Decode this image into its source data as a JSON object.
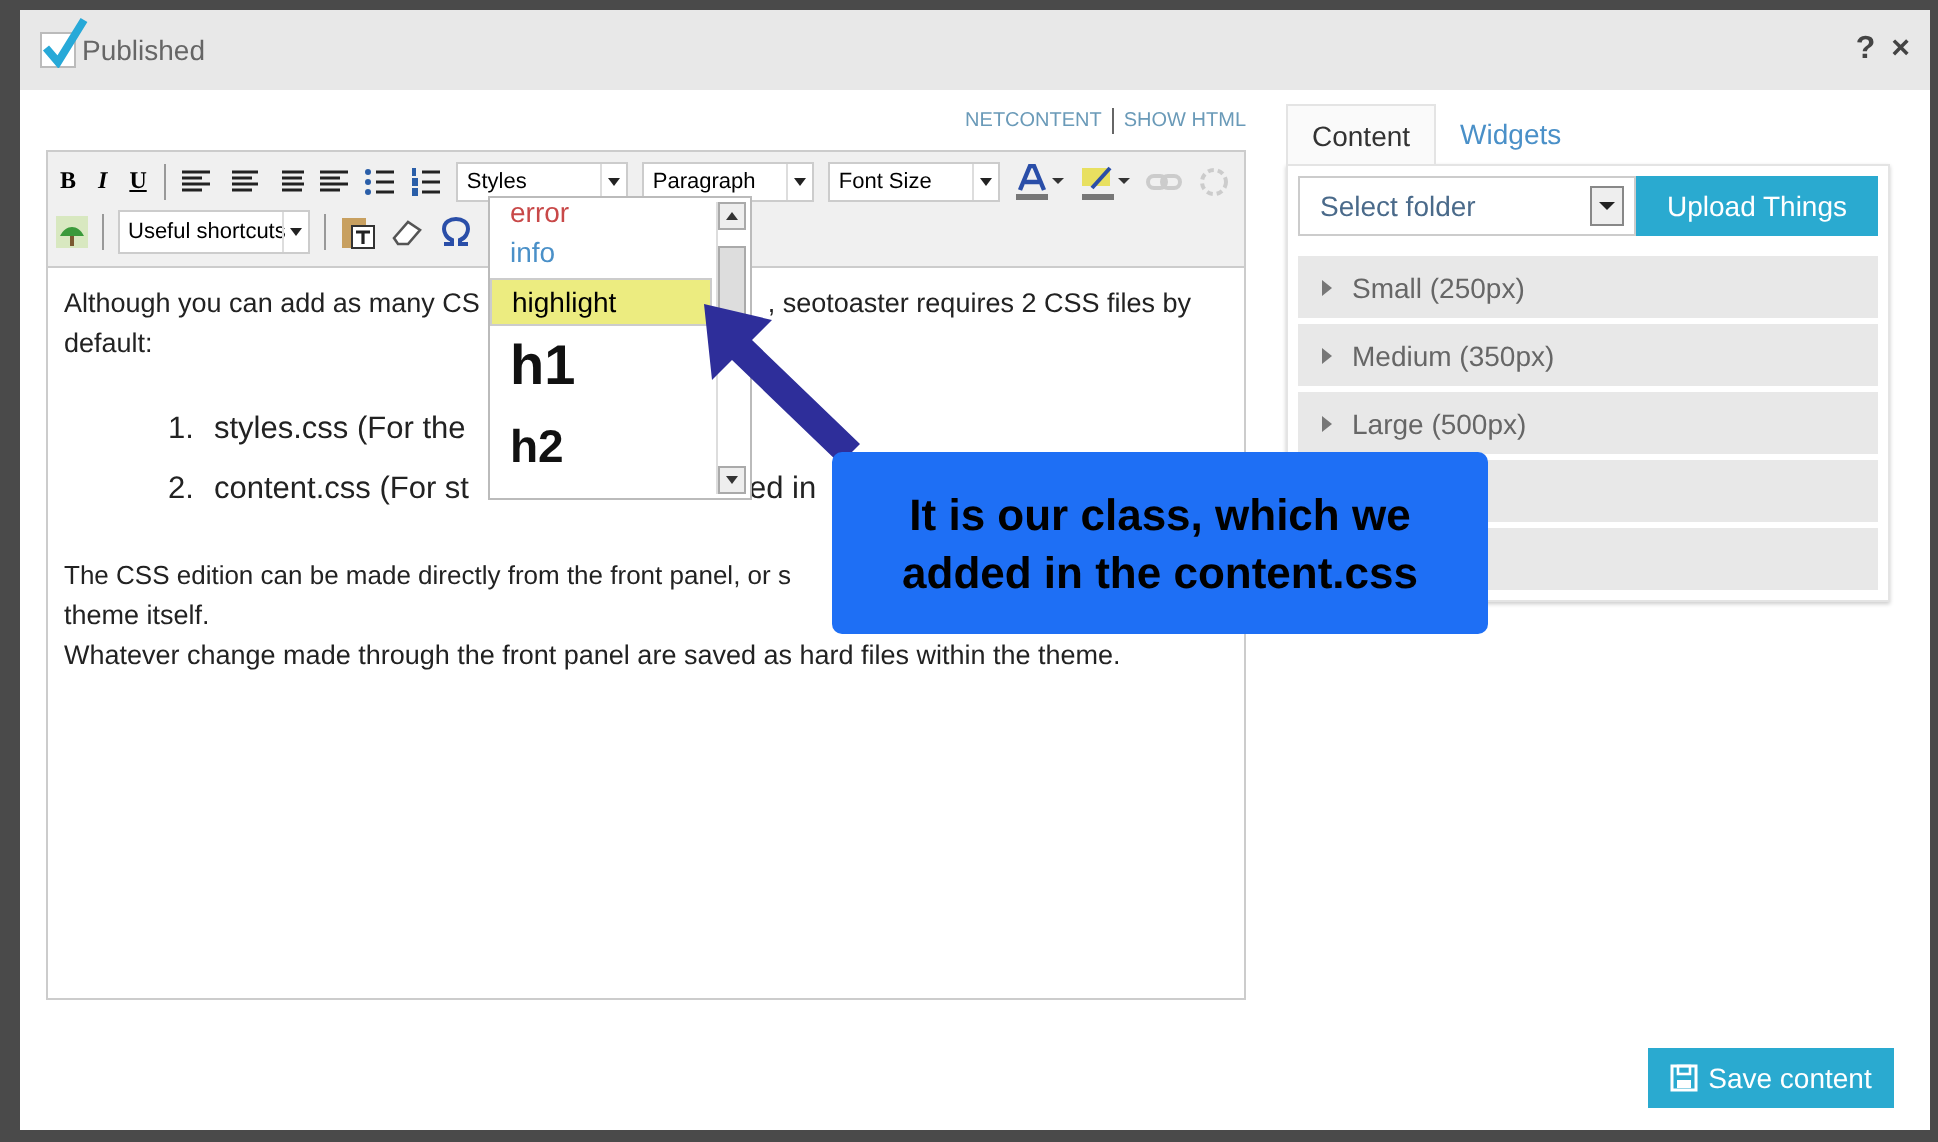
{
  "window": {
    "published": {
      "label": "Published",
      "checked": true
    },
    "help": "?",
    "close": "×"
  },
  "editor_links": [
    "NETCONTENT",
    "SHOW HTML"
  ],
  "toolbar": {
    "format_buttons": [
      "B",
      "I",
      "U"
    ],
    "selects": [
      "Styles",
      "Paragraph",
      "Font Size"
    ],
    "shortcuts": "Useful shortcuts"
  },
  "styles_menu": [
    {
      "label": "error",
      "kind": "error",
      "selected": false
    },
    {
      "label": "info",
      "kind": "info",
      "selected": false
    },
    {
      "label": "highlight",
      "kind": "highlight",
      "selected": true
    },
    {
      "label": "h1",
      "kind": "h1",
      "selected": false
    },
    {
      "label": "h2",
      "kind": "h2",
      "selected": false
    }
  ],
  "body": {
    "intro": [
      "Although you can add as many CS",
      ", seotoaster requires 2 CSS files by",
      "default:"
    ],
    "list": [
      {
        "number": "1.",
        "parts": [
          "styles.css (For the"
        ]
      },
      {
        "number": "2.",
        "parts": [
          "content.css (For st",
          "ed in"
        ]
      }
    ],
    "para_a": "The CSS edition can be made directly from the front panel, or s",
    "para_b": "theme itself.",
    "para_c": "Whatever change made through the front panel are saved as hard files within the theme."
  },
  "callout": "It is our class, which we added in the content.css",
  "side": {
    "tabs": [
      {
        "label": "Content",
        "selected": true
      },
      {
        "label": "Widgets",
        "selected": false
      }
    ],
    "folder_select": {
      "placeholder": "Select folder"
    },
    "upload": "Upload Things",
    "folders": [
      "Small (250px)",
      "Medium (350px)",
      "Large (500px)"
    ]
  },
  "save": "Save content"
}
